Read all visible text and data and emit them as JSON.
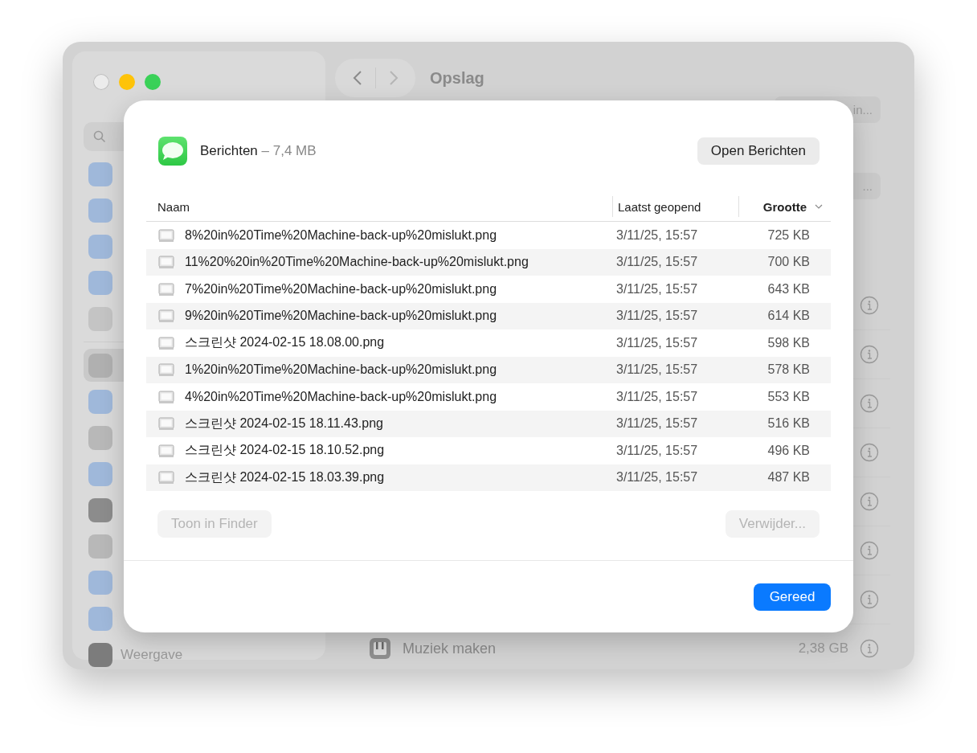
{
  "window": {
    "title": "Opslag",
    "sidebar": {
      "groups": [
        {
          "items": [
            {
              "color": "#9fb8da",
              "selected": false
            },
            {
              "color": "#9fb8da",
              "selected": false
            },
            {
              "color": "#9fb8da",
              "selected": false
            },
            {
              "color": "#9fb8da",
              "selected": false
            },
            {
              "color": "#c4c4c4",
              "selected": false
            }
          ]
        },
        {
          "items": [
            {
              "color": "#b0b0b0",
              "selected": true
            },
            {
              "color": "#9fb8da",
              "selected": false
            },
            {
              "color": "#b8b8b8",
              "selected": false
            },
            {
              "color": "#9fb8da",
              "selected": false
            },
            {
              "color": "#8c8c8c",
              "selected": false
            },
            {
              "color": "#b8b8b8",
              "selected": false
            },
            {
              "color": "#9fb8da",
              "selected": false
            },
            {
              "color": "#9fb8da",
              "selected": false
            },
            {
              "label": "Weergave",
              "color": "#7c7c7c",
              "selected": false
            }
          ]
        }
      ]
    },
    "top_buttons": [
      "in...",
      "..."
    ],
    "storage_rows": [
      {},
      {},
      {},
      {},
      {},
      {},
      {},
      {
        "name": "Muziek maken",
        "size": "2,38 GB"
      }
    ]
  },
  "dialog": {
    "app_name": "Berichten",
    "app_size": "– 7,4 MB",
    "open_button": "Open Berichten",
    "columns": [
      {
        "label": "Naam",
        "sorted": false
      },
      {
        "label": "Laatst geopend",
        "sorted": false
      },
      {
        "label": "Grootte",
        "sorted": true
      }
    ],
    "rows": [
      {
        "name": "8%20in%20Time%20Machine-back-up%20mislukt.png",
        "last_opened": "3/11/25, 15:57",
        "size": "725 KB"
      },
      {
        "name": "11%20%20in%20Time%20Machine-back-up%20mislukt.png",
        "last_opened": "3/11/25, 15:57",
        "size": "700 KB"
      },
      {
        "name": "7%20in%20Time%20Machine-back-up%20mislukt.png",
        "last_opened": "3/11/25, 15:57",
        "size": "643 KB"
      },
      {
        "name": "9%20in%20Time%20Machine-back-up%20mislukt.png",
        "last_opened": "3/11/25, 15:57",
        "size": "614 KB"
      },
      {
        "name": "스크린샷 2024-02-15 18.08.00.png",
        "last_opened": "3/11/25, 15:57",
        "size": "598 KB"
      },
      {
        "name": "1%20in%20Time%20Machine-back-up%20mislukt.png",
        "last_opened": "3/11/25, 15:57",
        "size": "578 KB"
      },
      {
        "name": "4%20in%20Time%20Machine-back-up%20mislukt.png",
        "last_opened": "3/11/25, 15:57",
        "size": "553 KB"
      },
      {
        "name": "스크린샷 2024-02-15 18.11.43.png",
        "last_opened": "3/11/25, 15:57",
        "size": "516 KB"
      },
      {
        "name": "스크린샷 2024-02-15 18.10.52.png",
        "last_opened": "3/11/25, 15:57",
        "size": "496 KB"
      },
      {
        "name": "스크린샷 2024-02-15 18.03.39.png",
        "last_opened": "3/11/25, 15:57",
        "size": "487 KB"
      }
    ],
    "left_button": {
      "label": "Toon in Finder",
      "disabled": true
    },
    "right_button": {
      "label": "Verwijder...",
      "disabled": true
    },
    "done_button": "Gereed"
  }
}
